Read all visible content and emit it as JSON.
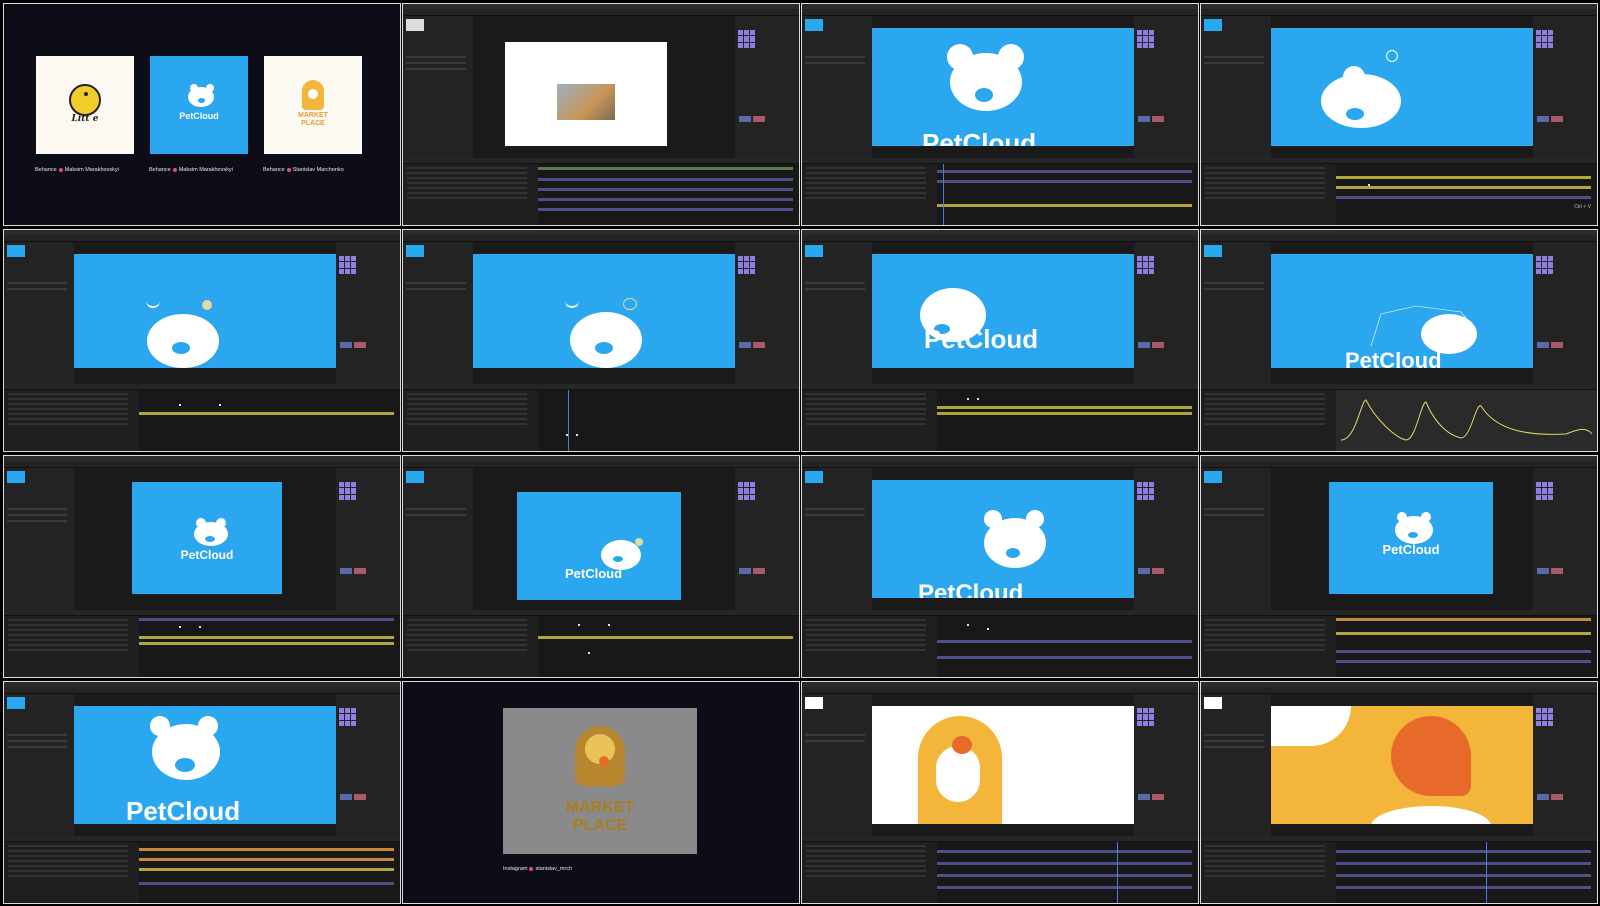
{
  "intro": {
    "cards": [
      {
        "logo_text": "Litt e",
        "caption_prefix": "Behance",
        "caption_author": "Maksim Marakhovskyi",
        "bg": "#fdf9f2"
      },
      {
        "logo_text": "PetCloud",
        "caption_prefix": "Behance",
        "caption_author": "Maksim Marakhovskyi",
        "bg": "#2ba7ef"
      },
      {
        "logo_text": "MARKET PLACE",
        "caption_prefix": "Behance",
        "caption_author": "Stanislav Marchenko",
        "bg": "#fdfaf4"
      }
    ]
  },
  "brand": {
    "petcloud": "PetCloud",
    "market": "MARKET PLACE",
    "market_line1": "MARKET",
    "market_line2": "PLACE"
  },
  "instagram": {
    "prefix": "Instagram",
    "handle": "stanislav_mrch"
  },
  "shortcut_hint": "Ctrl + V",
  "colors": {
    "petcloud_blue": "#2ba7ef",
    "market_yellow": "#f3b53a",
    "market_orange": "#e86a2a",
    "ae_panel": "#232323",
    "layer_yellow": "#b3a53d",
    "layer_purple": "#4d4f87"
  },
  "icons": [
    "bird-logo-icon",
    "bear-cloud-icon",
    "dog-logo-icon",
    "bell-icon"
  ]
}
